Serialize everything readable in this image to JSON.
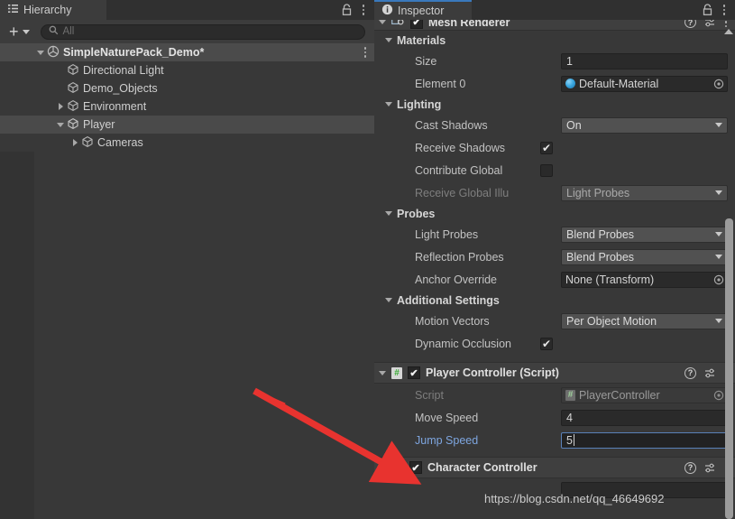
{
  "hierarchy": {
    "tab_label": "Hierarchy",
    "toolbar": {
      "add_label": "+",
      "search_placeholder": "All",
      "search_value": ""
    },
    "tree": [
      {
        "label": "SimpleNaturePack_Demo*",
        "depth": 0,
        "twisty": "down",
        "icon": "scene-icon",
        "row_type": "scene",
        "has_kebab": true
      },
      {
        "label": "Directional Light",
        "depth": 1,
        "twisty": "none",
        "icon": "gameobject-icon",
        "row_type": "normal",
        "has_kebab": false
      },
      {
        "label": "Demo_Objects",
        "depth": 1,
        "twisty": "none",
        "icon": "gameobject-icon",
        "row_type": "normal",
        "has_kebab": false
      },
      {
        "label": "Environment",
        "depth": 1,
        "twisty": "right",
        "icon": "gameobject-icon",
        "row_type": "normal",
        "has_kebab": false
      },
      {
        "label": "Player",
        "depth": 1,
        "twisty": "down",
        "icon": "gameobject-icon",
        "row_type": "selected",
        "has_kebab": false
      },
      {
        "label": "Cameras",
        "depth": 2,
        "twisty": "right",
        "icon": "gameobject-icon",
        "row_type": "normal",
        "has_kebab": false
      }
    ]
  },
  "inspector": {
    "tab_label": "Inspector",
    "mesh_renderer": {
      "title": "Mesh Renderer",
      "enabled": true
    },
    "sections": {
      "materials": {
        "title": "Materials",
        "size_label": "Size",
        "size_value": "1",
        "element0_label": "Element 0",
        "element0_value": "Default-Material"
      },
      "lighting": {
        "title": "Lighting",
        "cast_shadows_label": "Cast Shadows",
        "cast_shadows_value": "On",
        "receive_shadows_label": "Receive Shadows",
        "receive_shadows_checked": "✔",
        "contribute_global_label": "Contribute Global",
        "receive_gi_label": "Receive Global Illu",
        "receive_gi_value": "Light Probes"
      },
      "probes": {
        "title": "Probes",
        "light_probes_label": "Light Probes",
        "light_probes_value": "Blend Probes",
        "reflection_probes_label": "Reflection Probes",
        "reflection_probes_value": "Blend Probes",
        "anchor_override_label": "Anchor Override",
        "anchor_override_value": "None (Transform)"
      },
      "additional": {
        "title": "Additional Settings",
        "motion_vectors_label": "Motion Vectors",
        "motion_vectors_value": "Per Object Motion",
        "dynamic_occlusion_label": "Dynamic Occlusion",
        "dynamic_occlusion_checked": "✔"
      }
    },
    "player_controller": {
      "title": "Player Controller (Script)",
      "enabled_mark": "✔",
      "script_label": "Script",
      "script_value": "PlayerController",
      "move_speed_label": "Move Speed",
      "move_speed_value": "4",
      "jump_speed_label": "Jump Speed",
      "jump_speed_value": "5"
    },
    "character_controller": {
      "title": "Character Controller",
      "enabled_mark": "✔"
    }
  },
  "watermark": {
    "text": "https://blog.csdn.net/qq_46649692"
  },
  "colors": {
    "accent_blue": "#3a79bc",
    "focus_border": "#5a81b8",
    "modified_label": "#7ea6e0",
    "panel_bg": "#383838",
    "arrow_red": "#e8332f"
  }
}
